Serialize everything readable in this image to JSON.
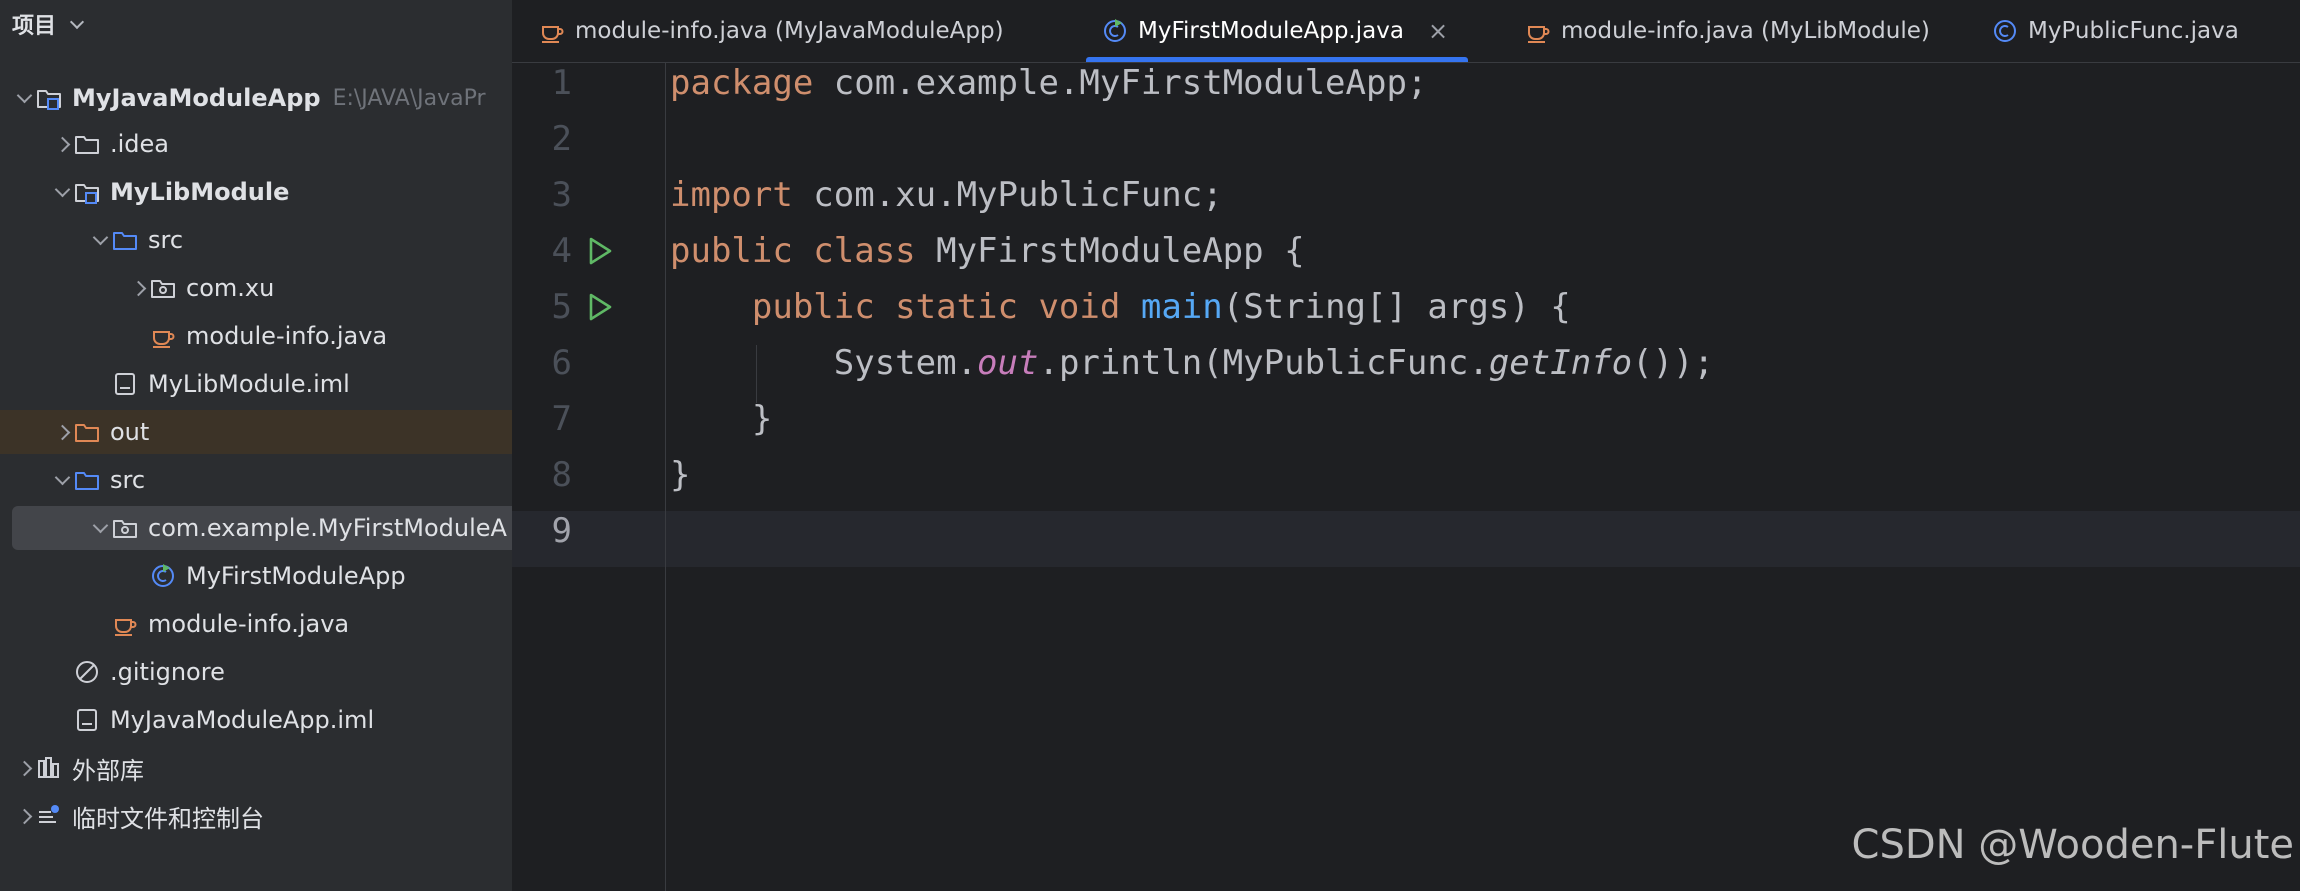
{
  "panel": {
    "title": "项目"
  },
  "tree": [
    {
      "label": "MyJavaModuleApp",
      "hint": "E:\\JAVA\\JavaPr",
      "icon": "module-folder-icon",
      "expanded": true,
      "bold": true
    },
    {
      "label": ".idea",
      "icon": "folder-icon",
      "expanded": false
    },
    {
      "label": "MyLibModule",
      "icon": "module-folder-icon",
      "expanded": true,
      "bold": true
    },
    {
      "label": "src",
      "icon": "source-folder-icon",
      "expanded": true
    },
    {
      "label": "com.xu",
      "icon": "package-icon",
      "expanded": false
    },
    {
      "label": "module-info.java",
      "icon": "java-file-icon"
    },
    {
      "label": "MyLibModule.iml",
      "icon": "iml-file-icon"
    },
    {
      "label": "out",
      "icon": "excluded-folder-icon",
      "expanded": false
    },
    {
      "label": "src",
      "icon": "source-folder-icon",
      "expanded": true
    },
    {
      "label": "com.example.MyFirstModuleA",
      "icon": "package-icon",
      "expanded": true,
      "selected": true
    },
    {
      "label": "MyFirstModuleApp",
      "icon": "runnable-class-icon"
    },
    {
      "label": "module-info.java",
      "icon": "java-file-icon"
    },
    {
      "label": ".gitignore",
      "icon": "ignored-file-icon"
    },
    {
      "label": "MyJavaModuleApp.iml",
      "icon": "iml-file-icon"
    },
    {
      "label": "外部库",
      "icon": "libraries-icon",
      "expanded": false
    },
    {
      "label": "临时文件和控制台",
      "icon": "scratches-icon",
      "expanded": false
    }
  ],
  "tabs": [
    {
      "label": "module-info.java (MyJavaModuleApp)",
      "icon": "java-file-icon"
    },
    {
      "label": "MyFirstModuleApp.java",
      "icon": "runnable-class-icon",
      "active": true,
      "close": "×"
    },
    {
      "label": "module-info.java (MyLibModule)",
      "icon": "java-file-icon"
    },
    {
      "label": "MyPublicFunc.java",
      "icon": "class-icon"
    }
  ],
  "editor": {
    "line_numbers": [
      "1",
      "2",
      "3",
      "4",
      "5",
      "6",
      "7",
      "8",
      "9"
    ],
    "current_line": "9",
    "lines": [
      [
        {
          "t": "package",
          "c": "kw"
        },
        {
          "t": " com.example.MyFirstModuleApp;"
        }
      ],
      [],
      [
        {
          "t": "import",
          "c": "kw"
        },
        {
          "t": " com.xu.MyPublicFunc;"
        }
      ],
      [
        {
          "t": "public class",
          "c": "kw"
        },
        {
          "t": " MyFirstModuleApp {"
        }
      ],
      [
        {
          "t": "    "
        },
        {
          "t": "public static void",
          "c": "kw"
        },
        {
          "t": " "
        },
        {
          "t": "main",
          "c": "fn"
        },
        {
          "t": "(String[] args) {"
        }
      ],
      [
        {
          "t": "        System."
        },
        {
          "t": "out",
          "c": "st"
        },
        {
          "t": ".println(MyPublicFunc."
        },
        {
          "t": "getInfo",
          "c": "it"
        },
        {
          "t": "());"
        }
      ],
      [
        {
          "t": "    }"
        }
      ],
      [
        {
          "t": "}"
        }
      ],
      []
    ],
    "run_lines": [
      "4",
      "5"
    ]
  },
  "watermark": "CSDN @Wooden-Flute",
  "colors": {
    "accent": "#3574f0",
    "keyword": "#cf8e6d",
    "method": "#56a8f5",
    "static_field": "#c77dbb",
    "run_icon": "#5fb865"
  }
}
